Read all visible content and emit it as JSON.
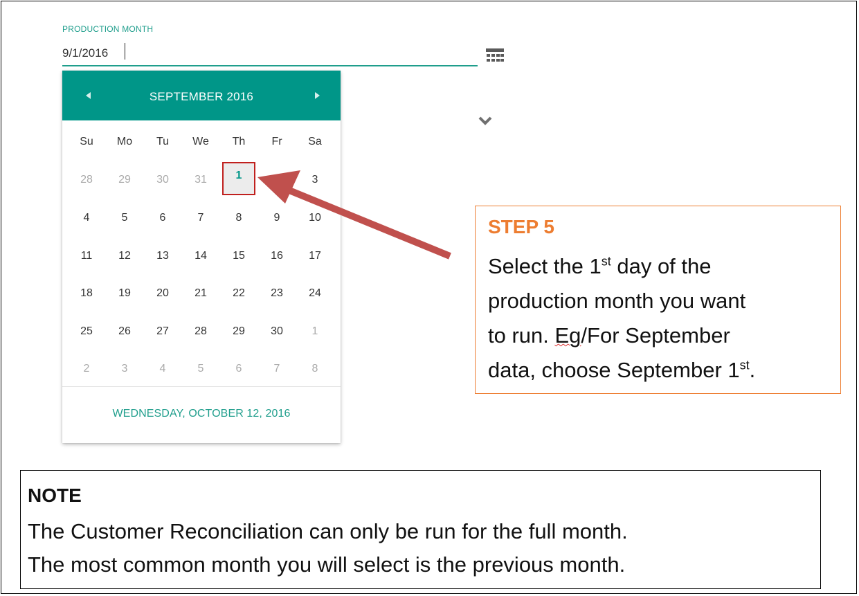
{
  "field": {
    "label": "PRODUCTION MONTH",
    "value": "9/1/2016"
  },
  "calendar": {
    "month_title": "SEPTEMBER 2016",
    "weekdays": [
      "Su",
      "Mo",
      "Tu",
      "We",
      "Th",
      "Fr",
      "Sa"
    ],
    "weeks": [
      [
        "28",
        "29",
        "30",
        "31",
        "1",
        "",
        "3"
      ],
      [
        "4",
        "5",
        "6",
        "7",
        "8",
        "9",
        "10"
      ],
      [
        "11",
        "12",
        "13",
        "14",
        "15",
        "16",
        "17"
      ],
      [
        "18",
        "19",
        "20",
        "21",
        "22",
        "23",
        "24"
      ],
      [
        "25",
        "26",
        "27",
        "28",
        "29",
        "30",
        "1"
      ],
      [
        "2",
        "3",
        "4",
        "5",
        "6",
        "7",
        "8"
      ]
    ],
    "today_label": "WEDNESDAY, OCTOBER 12, 2016",
    "header_color": "#009688",
    "accent_color": "#1f9e8c"
  },
  "step": {
    "title": "STEP 5",
    "line1_a": "Select the 1",
    "line1_sup": "st",
    "line1_b": " day of the",
    "line2": "production month you want",
    "line3_a": "to run. ",
    "line3_eg": "Eg",
    "line3_b": "/For September",
    "line4_a": "data, choose September 1",
    "line4_sup": "st",
    "line4_b": ".",
    "border_color": "#ed7d31"
  },
  "note": {
    "title": "NOTE",
    "line1": "The Customer Reconciliation can only be run for the full month.",
    "line2": "The most common month you will select is the previous month."
  },
  "icons": {
    "calendar_button": "calendar-grid-icon",
    "expand": "chevron-down-icon",
    "prev": "chevron-left-icon",
    "next": "chevron-right-icon"
  }
}
